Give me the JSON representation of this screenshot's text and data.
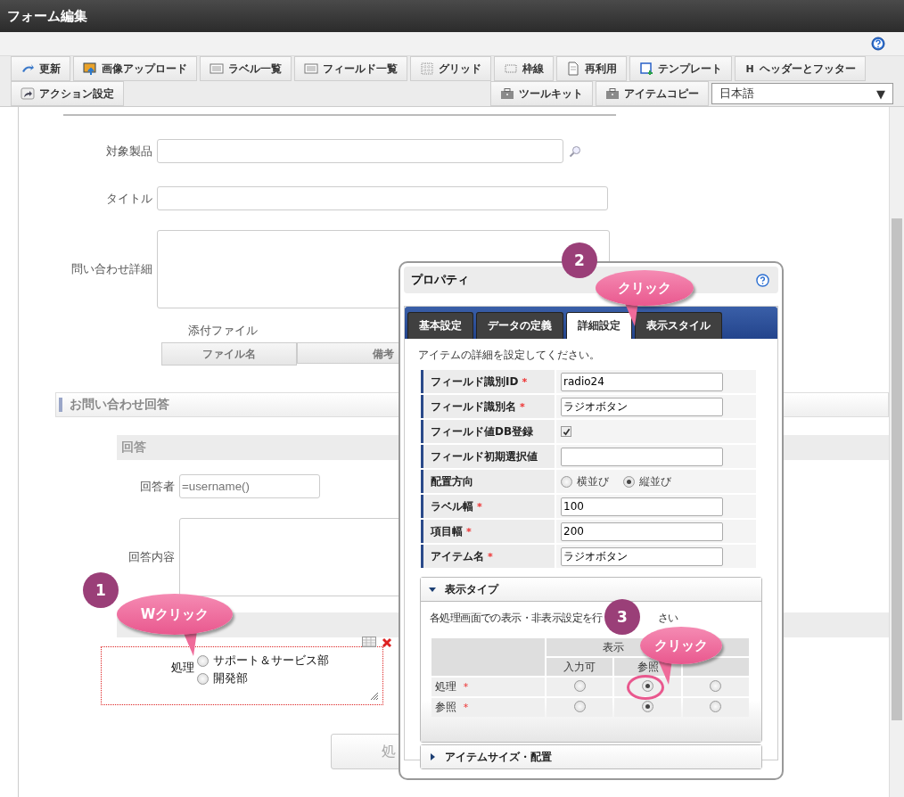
{
  "window": {
    "title": "フォーム編集"
  },
  "toolbar": {
    "row_1": [
      {
        "label": "更新"
      },
      {
        "label": "画像アップロード"
      },
      {
        "label": "ラベル一覧"
      },
      {
        "label": "フィールド一覧"
      },
      {
        "label": "グリッド"
      },
      {
        "label": "枠線"
      },
      {
        "label": "再利用"
      },
      {
        "label": "テンプレート"
      },
      {
        "label": "ヘッダーとフッター",
        "glyph": "H"
      }
    ],
    "row_2_left": [
      {
        "label": "アクション設定"
      }
    ],
    "row_2_right": [
      {
        "label": "ツールキット"
      },
      {
        "label": "アイテムコピー"
      }
    ],
    "language": {
      "value": "日本語",
      "arrow": "▼"
    }
  },
  "form": {
    "fields": [
      {
        "label": "対象製品",
        "kind": "search"
      },
      {
        "label": "タイトル",
        "kind": "text"
      },
      {
        "label": "問い合わせ詳細",
        "kind": "textarea"
      }
    ],
    "attachments": {
      "label": "添付ファイル",
      "columns": [
        "ファイル名",
        "備考"
      ]
    },
    "section": {
      "title": "お問い合わせ回答",
      "subsection": "回答",
      "fields": [
        {
          "label": "回答者",
          "kind": "text",
          "placeholder": "=username()"
        },
        {
          "label": "回答内容",
          "kind": "textarea"
        }
      ]
    },
    "radio_item": {
      "label": "処理",
      "selected": true,
      "options": [
        {
          "label": "サポート＆サービス部",
          "selected": false
        },
        {
          "label": "開発部",
          "selected": false
        }
      ]
    },
    "button": {
      "label": "処"
    }
  },
  "properties": {
    "title": "プロパティ",
    "tabs": [
      {
        "label": "基本設定",
        "selected": false
      },
      {
        "label": "データの定義",
        "selected": false
      },
      {
        "label": "詳細設定",
        "selected": true
      },
      {
        "label": "表示スタイル",
        "selected": false
      }
    ],
    "description": "アイテムの詳細を設定してください。",
    "rows": [
      {
        "label": "フィールド識別ID",
        "required_mark": "*",
        "kind": "input",
        "value": "radio24"
      },
      {
        "label": "フィールド識別名",
        "required_mark": "*",
        "kind": "input",
        "value": "ラジオボタン"
      },
      {
        "label": "フィールド値DB登録",
        "kind": "checkbox",
        "checked": true
      },
      {
        "label": "フィールド初期選択値",
        "kind": "input"
      },
      {
        "label": "配置方向",
        "kind": "radio",
        "options": [
          {
            "label": "横並び",
            "selected": false
          },
          {
            "label": "縦並び",
            "selected": true
          }
        ]
      },
      {
        "label": "ラベル幅",
        "required_mark": "*",
        "kind": "input",
        "value": "100"
      },
      {
        "label": "項目幅",
        "required_mark": "*",
        "kind": "input",
        "value": "200"
      },
      {
        "label": "アイテム名",
        "required_mark": "*",
        "kind": "input",
        "value": "ラジオボタン"
      }
    ],
    "display_type": {
      "title": "表示タイプ",
      "expanded": true,
      "note_start": "各処理画面での表示・非表示設定を行",
      "note_end": "さい",
      "group_header": "表示",
      "columns": [
        "入力可",
        "参照"
      ],
      "rows": [
        {
          "label": "処理",
          "required_mark": "*",
          "options": [
            {
              "selected": false
            },
            {
              "selected": true
            },
            {
              "selected": false
            }
          ]
        },
        {
          "label": "参照",
          "required_mark": "*",
          "options": [
            {
              "selected": false
            },
            {
              "selected": true
            },
            {
              "selected": false
            }
          ]
        }
      ]
    },
    "size_section": {
      "title": "アイテムサイズ・配置",
      "expanded": false
    }
  },
  "callouts": [
    {
      "number": "1",
      "label": "Wクリック"
    },
    {
      "number": "2",
      "label": "クリック"
    },
    {
      "number": "3",
      "label": "クリック"
    }
  ]
}
